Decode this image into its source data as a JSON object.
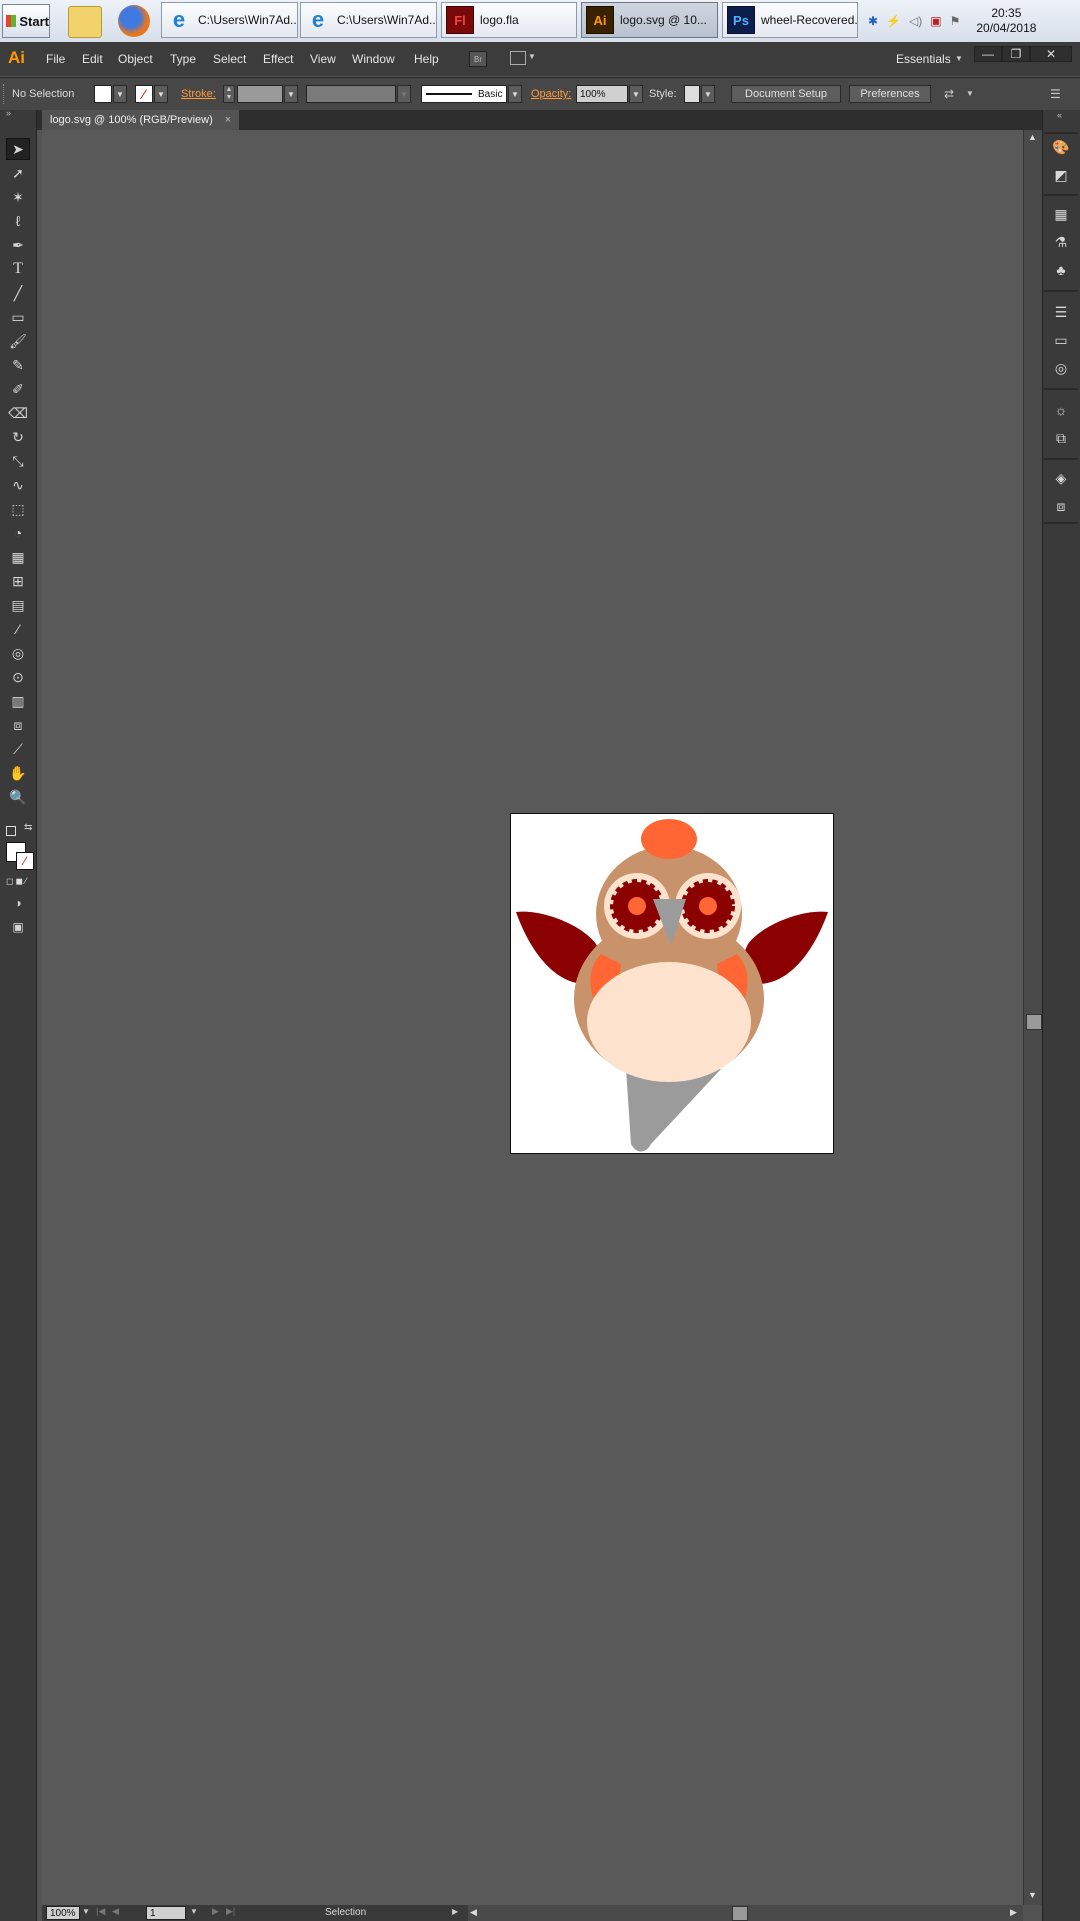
{
  "taskbar": {
    "start_label": "Start",
    "buttons": [
      {
        "label": "C:\\Users\\Win7Ad..."
      },
      {
        "label": "C:\\Users\\Win7Ad..."
      },
      {
        "label": "logo.fla",
        "badge": "Fl"
      },
      {
        "label": "logo.svg @ 10...",
        "badge": "Ai"
      },
      {
        "label": "wheel-Recovered...",
        "badge": "Ps"
      }
    ],
    "clock_time": "20:35",
    "clock_date": "20/04/2018"
  },
  "menubar": {
    "app_logo": "Ai",
    "items": [
      "File",
      "Edit",
      "Object",
      "Type",
      "Select",
      "Effect",
      "View",
      "Window",
      "Help"
    ],
    "bridge_label": "Br",
    "workspace": "Essentials"
  },
  "controlbar": {
    "selection_label": "No Selection",
    "stroke_label": "Stroke:",
    "brush_label": "Basic",
    "opacity_label": "Opacity:",
    "opacity_value": "100%",
    "style_label": "Style:",
    "document_setup": "Document Setup",
    "preferences": "Preferences"
  },
  "document_tab": {
    "title": "logo.svg @ 100% (RGB/Preview)",
    "close": "×"
  },
  "statusbar": {
    "zoom": "100%",
    "artboard_number": "1",
    "tool_status": "Selection"
  },
  "colors": {
    "owl_body": "#c8936a",
    "owl_belly": "#fde3cd",
    "owl_wing": "#8b0000",
    "owl_accent": "#ff6633",
    "owl_beak": "#9b9b9b"
  }
}
